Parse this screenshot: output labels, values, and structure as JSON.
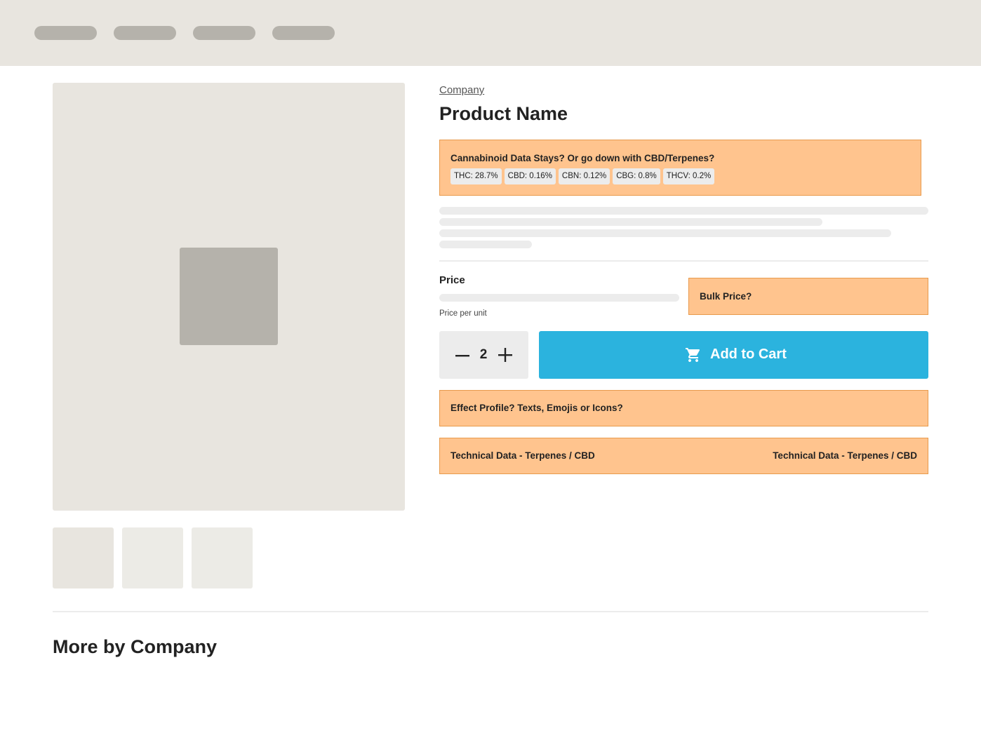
{
  "nav": {
    "pill_count": 4
  },
  "colors": {
    "topbar_bg": "#e8e5df",
    "placeholder": "#b5b2ab",
    "annotation_bg": "#ffc48e",
    "annotation_border": "#e89a4c",
    "accent": "#2bb3de",
    "skeleton": "#ececec"
  },
  "product": {
    "company_link": "Company",
    "name": "Product Name"
  },
  "cannabinoids": {
    "note": "Cannabinoid Data Stays? Or go down with CBD/Terpenes?",
    "chips": [
      {
        "label": "THC: 28.7%"
      },
      {
        "label": "CBD: 0.16%"
      },
      {
        "label": "CBN: 0.12%"
      },
      {
        "label": "CBG: 0.8%"
      },
      {
        "label": "THCV: 0.2%"
      }
    ]
  },
  "pricing": {
    "price_label": "Price",
    "price_per_unit": "Price per unit",
    "bulk_note": "Bulk Price?"
  },
  "quantity": {
    "value": "2",
    "minus_icon": "minus-icon",
    "plus_icon": "plus-icon"
  },
  "cart": {
    "label": "Add to Cart",
    "icon": "cart-icon"
  },
  "effects": {
    "note": "Effect Profile? Texts, Emojis or Icons?"
  },
  "technical": {
    "left_label": "Technical Data - Terpenes / CBD",
    "right_label": "Technical Data - Terpenes / CBD"
  },
  "more": {
    "title": "More by Company"
  }
}
